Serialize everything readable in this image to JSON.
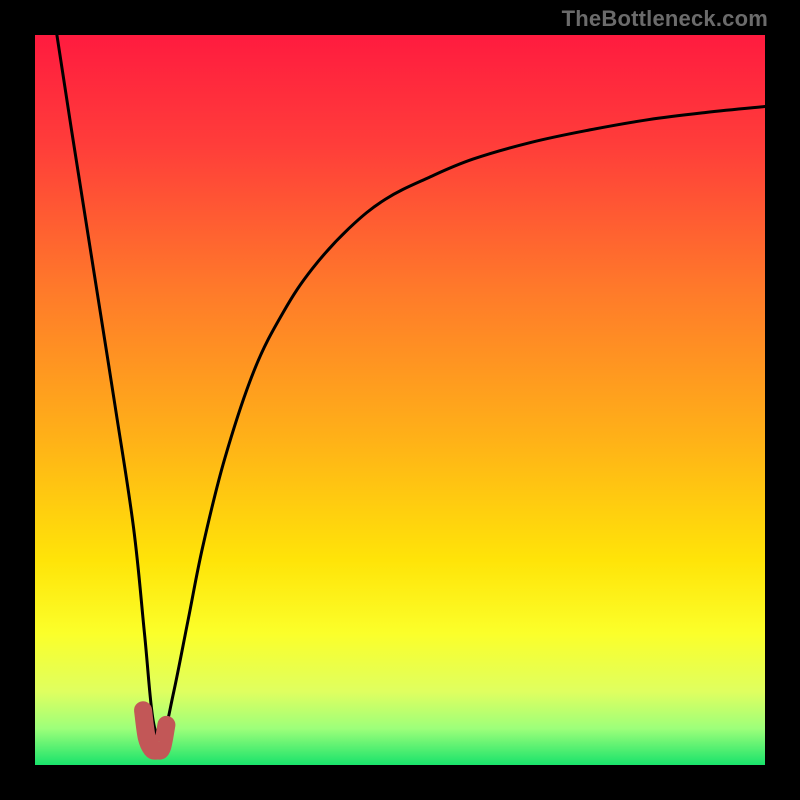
{
  "watermark": "TheBottleneck.com",
  "chart_data": {
    "type": "line",
    "title": "",
    "xlabel": "",
    "ylabel": "",
    "xlim": [
      0,
      100
    ],
    "ylim": [
      0,
      100
    ],
    "grid": false,
    "legend": false,
    "gradient_stops": [
      {
        "offset": 0.0,
        "color": "#ff1b3f"
      },
      {
        "offset": 0.15,
        "color": "#ff3d3a"
      },
      {
        "offset": 0.35,
        "color": "#ff7a2a"
      },
      {
        "offset": 0.55,
        "color": "#ffb018"
      },
      {
        "offset": 0.72,
        "color": "#ffe408"
      },
      {
        "offset": 0.82,
        "color": "#fbff2a"
      },
      {
        "offset": 0.9,
        "color": "#dfff60"
      },
      {
        "offset": 0.95,
        "color": "#9dff7a"
      },
      {
        "offset": 1.0,
        "color": "#19e36b"
      }
    ],
    "series": [
      {
        "name": "bottleneck-curve",
        "color": "#000000",
        "x": [
          3.0,
          5.0,
          8.0,
          11.0,
          13.5,
          15.0,
          16.2,
          17.5,
          19.0,
          21.0,
          23.0,
          26.0,
          30.0,
          34.0,
          38.0,
          43.0,
          48.0,
          54.0,
          60.0,
          68.0,
          76.0,
          84.0,
          92.0,
          100.0
        ],
        "y": [
          100.0,
          87.0,
          68.0,
          49.0,
          32.5,
          18.0,
          6.0,
          4.0,
          10.0,
          20.0,
          30.0,
          42.0,
          54.0,
          62.0,
          68.0,
          73.5,
          77.5,
          80.5,
          83.0,
          85.3,
          87.0,
          88.4,
          89.4,
          90.2
        ]
      }
    ],
    "highlight": {
      "name": "recommended-region",
      "color": "#c25757",
      "x": [
        14.8,
        15.3,
        16.0,
        16.7,
        17.4,
        18.0
      ],
      "y": [
        7.5,
        3.8,
        2.2,
        2.0,
        2.4,
        5.5
      ]
    }
  }
}
